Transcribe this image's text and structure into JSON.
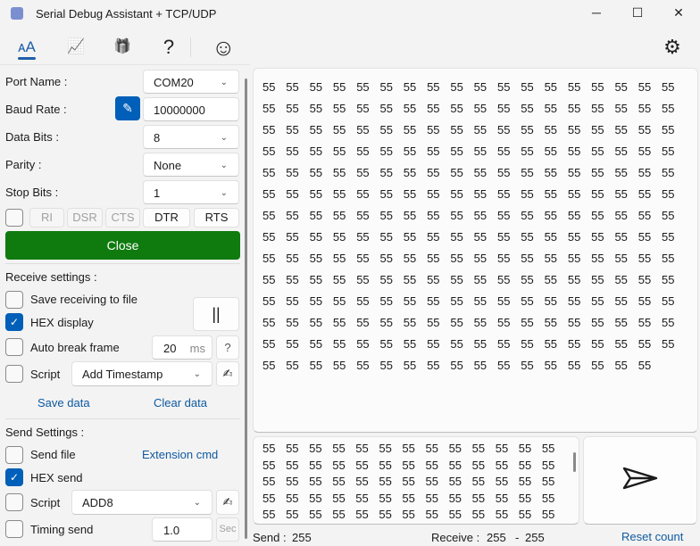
{
  "window": {
    "title": "Serial Debug Assistant + TCP/UDP",
    "minimize": "─",
    "maximize": "☐",
    "close": "✕"
  },
  "toolbar": {
    "icons": [
      "font-icon",
      "chart-icon",
      "gift-icon",
      "help-icon",
      "smiley-icon",
      "settings-icon"
    ],
    "glyphs": {
      "font": "ᴀA",
      "chart": "📈",
      "gift": "🎁",
      "help": "?",
      "smiley": "☺",
      "settings": "⚙"
    }
  },
  "serial": {
    "port_label": "Port Name :",
    "port_value": "COM20",
    "baud_label": "Baud Rate :",
    "baud_value": "10000000",
    "databits_label": "Data Bits :",
    "databits_value": "8",
    "parity_label": "Parity :",
    "parity_value": "None",
    "stopbits_label": "Stop Bits :",
    "stopbits_value": "1",
    "signals": [
      "RI",
      "DSR",
      "CTS",
      "DTR",
      "RTS"
    ],
    "close_label": "Close",
    "accent": "#0f7b0f"
  },
  "receive": {
    "heading": "Receive settings :",
    "save_to_file": "Save receiving to file",
    "hex_display": "HEX display",
    "auto_break": "Auto break frame",
    "break_value": "20",
    "break_unit": "ms",
    "help": "?",
    "script": "Script",
    "script_value": "Add Timestamp",
    "pause": "||",
    "save_data": "Save data",
    "clear_data": "Clear data",
    "data": "55 55 55 55 55 55 55 55 55 55 55 55 55 55 55 55 55 55 55 55 55 55 55 55 55 55 55 55 55 55 55 55 55 55 55 55 55 55 55 55 55 55 55 55 55 55 55 55 55 55 55 55 55 55 55 55 55 55 55 55 55 55 55 55 55 55 55 55 55 55 55 55 55 55 55 55 55 55 55 55 55 55 55 55 55 55 55 55 55 55 55 55 55 55 55 55 55 55 55 55 55 55 55 55 55 55 55 55 55 55 55 55 55 55 55 55 55 55 55 55 55 55 55 55 55 55 55 55 55 55 55 55 55 55 55 55 55 55 55 55 55 55 55 55 55 55 55 55 55 55 55 55 55 55 55 55 55 55 55 55 55 55 55 55 55 55 55 55 55 55 55 55 55 55 55 55 55 55 55 55 55 55 55 55 55 55 55 55 55 55 55 55 55 55 55 55 55 55 55 55 55 55 55 55 55 55 55 55 55 55 55 55 55 55 55 55 55 55 55 55 55 55 55 55 55 55 55 55 55 55 55 55 55 55 55 55 55 55 55 55 55 55 55 55 55 55 55 55 55 55 55"
  },
  "send": {
    "heading": "Send Settings :",
    "send_file": "Send file",
    "extension_cmd": "Extension cmd",
    "hex_send": "HEX send",
    "script": "Script",
    "script_value": "ADD8",
    "timing": "Timing send",
    "timing_value": "1.0",
    "timing_unit": "Sec",
    "data": "55 55 55 55 55 55 55 55 55 55 55 55 55 55 55 55 55 55 55 55 55 55 55 55 55 55 55 55 55 55 55 55 55 55 55 55 55 55 55 55 55 55 55 55 55 55 55 55 55 55 55 55 55 55 55 55 55 55 55 55 55 55 55 55 55 55 55 55 55 55 55 55 55 55 55 55 55 55 55 55 55 55 55 55 55 55 55 55 55 55 55 55 55 55 55 55 55 55 55 55 55 55 55 55 55 55 55 55 55 55 55 55 55 55 55 55 55 55 55 55 55 55 55 55 55 55 55 55 55 55 55 55 55 55 55 55 55 55 55 55 55 55 55 55 55 55 55 55 55 55 55 55 55 55 55 55 55 55 55 55 55 55 55 55 55 55 55 55 55 55 55 55 55 55 55 55 55 55 55 55 55 55 55 55 55 55 55 55 55 55 55 55 55 55 55 55 55 55 55 55 55 55 55 55 55 55 55 55 55 55 55 55 55 55 55 55 55 55 55 55 55 55 55 55 55 55 55 55 55 55 55 55 55 55 55 55 55 55 55 55 55 55 55 55 55 55 55 55 55 55 55"
  },
  "status": {
    "send_label": "Send :",
    "send_count": "255",
    "receive_label": "Receive :",
    "receive_count": "255",
    "receive_sep": "-",
    "receive_count2": "255",
    "reset": "Reset count"
  }
}
